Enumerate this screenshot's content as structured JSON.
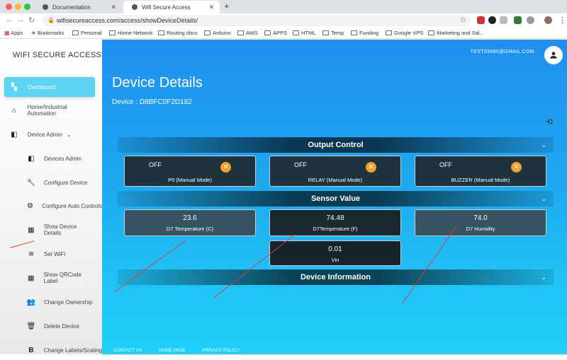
{
  "browser": {
    "tabs": [
      {
        "title": "Documentation"
      },
      {
        "title": "Wifi Secure Access"
      }
    ],
    "url": "wifisecureaccess.com/access/showDeviceDetails/",
    "bookmarks": [
      "Apps",
      "Bookmarks",
      "Personal",
      "Home Network",
      "Routing docs",
      "Arduino",
      "AWS",
      "APPS",
      "HTML",
      "Temp",
      "Funding",
      "Google VPS",
      "Marketing and Sal..."
    ]
  },
  "sidebar": {
    "brand": "WIFI SECURE ACCESS",
    "items": [
      {
        "label": "Dashboard",
        "icon": "dashboard-icon"
      },
      {
        "label": "Home/Industrial Automation",
        "icon": "factory-icon"
      },
      {
        "label": "Device Admin",
        "icon": "device-admin-icon"
      },
      {
        "label": "Devices Admin",
        "icon": "devices-admin-icon"
      },
      {
        "label": "Configure Device",
        "icon": "wrench-icon"
      },
      {
        "label": "Configure Auto Controls",
        "icon": "gear-icon"
      },
      {
        "label": "Show Device Details",
        "icon": "grid-icon"
      },
      {
        "label": "Set WiFi",
        "icon": "wifi-icon"
      },
      {
        "label": "Show QRCode Label",
        "icon": "qrcode-icon"
      },
      {
        "label": "Change Ownership",
        "icon": "people-icon"
      },
      {
        "label": "Delete Device",
        "icon": "trash-icon"
      },
      {
        "label": "Change Labels/Scaling",
        "icon": "bold-b-icon"
      }
    ]
  },
  "header": {
    "email": "TEST53680@GMAIL.COM"
  },
  "page": {
    "title": "Device Details",
    "device": "Device : D8BFC0F2D182"
  },
  "output_control": {
    "title": "Output Control",
    "cards": [
      {
        "state": "OFF",
        "label": "P0 (Manual Mode)"
      },
      {
        "state": "OFF",
        "label": "RELAY (Manual Mode)"
      },
      {
        "state": "OFF",
        "label": "BUZZER (Manual Mode)"
      }
    ]
  },
  "sensor_value": {
    "title": "Sensor Value",
    "cards": [
      {
        "value": "23.6",
        "label": "D7 Temperature (C)"
      },
      {
        "value": "74.48",
        "label": "D7Temperature (F)"
      },
      {
        "value": "74.0",
        "label": "D7 Humidity"
      },
      {
        "value": "0.01",
        "label": "Vin"
      }
    ]
  },
  "device_information": {
    "title": "Device Information"
  },
  "footer": {
    "links": [
      "CONTACT US",
      "HOME PAGE",
      "PRIVACY POLICY"
    ]
  },
  "colors": {
    "accent": "#5bd3f3",
    "close_button": "#f2a02a",
    "annotation_arrow": "#e53935"
  }
}
